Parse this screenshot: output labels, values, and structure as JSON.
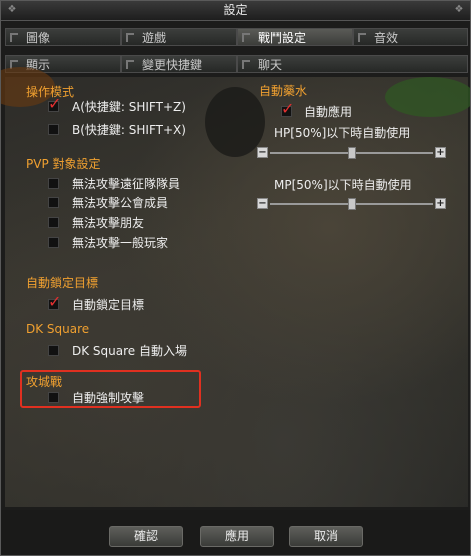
{
  "window": {
    "title": "設定"
  },
  "tabs": {
    "row1": [
      "圖像",
      "遊戲",
      "戰鬥設定",
      "音效"
    ],
    "row2": [
      "顯示",
      "變更快捷鍵",
      "聊天"
    ],
    "active": "戰鬥設定"
  },
  "left": {
    "operation_mode": {
      "title": "操作模式",
      "options": [
        {
          "label": "A(快捷鍵: SHIFT+Z)",
          "checked": true
        },
        {
          "label": "B(快捷鍵: SHIFT+X)",
          "checked": false
        }
      ]
    },
    "pvp_target": {
      "title": "PVP 對象設定",
      "options": [
        {
          "label": "無法攻擊遠征隊隊員",
          "checked": false
        },
        {
          "label": "無法攻擊公會成員",
          "checked": false
        },
        {
          "label": "無法攻擊朋友",
          "checked": false
        },
        {
          "label": "無法攻擊一般玩家",
          "checked": false
        }
      ]
    },
    "auto_lock": {
      "title": "自動鎖定目標",
      "options": [
        {
          "label": "自動鎖定目標",
          "checked": true
        }
      ]
    },
    "dk_square": {
      "title": "DK Square",
      "options": [
        {
          "label": "DK Square 自動入場",
          "checked": false
        }
      ]
    },
    "siege": {
      "title": "攻城戰",
      "options": [
        {
          "label": "自動強制攻擊",
          "checked": false
        }
      ]
    }
  },
  "right": {
    "auto_potion": {
      "title": "自動藥水",
      "apply_label": "自動應用",
      "apply_checked": true,
      "hp_label": "HP[50%]以下時自動使用",
      "hp_value": 0.5,
      "mp_label": "MP[50%]以下時自動使用",
      "mp_value": 0.5
    }
  },
  "buttons": {
    "confirm": "確認",
    "apply": "應用",
    "cancel": "取消"
  },
  "colors": {
    "section": "#f0a030",
    "check": "#e03030",
    "highlight": "#e03020"
  }
}
